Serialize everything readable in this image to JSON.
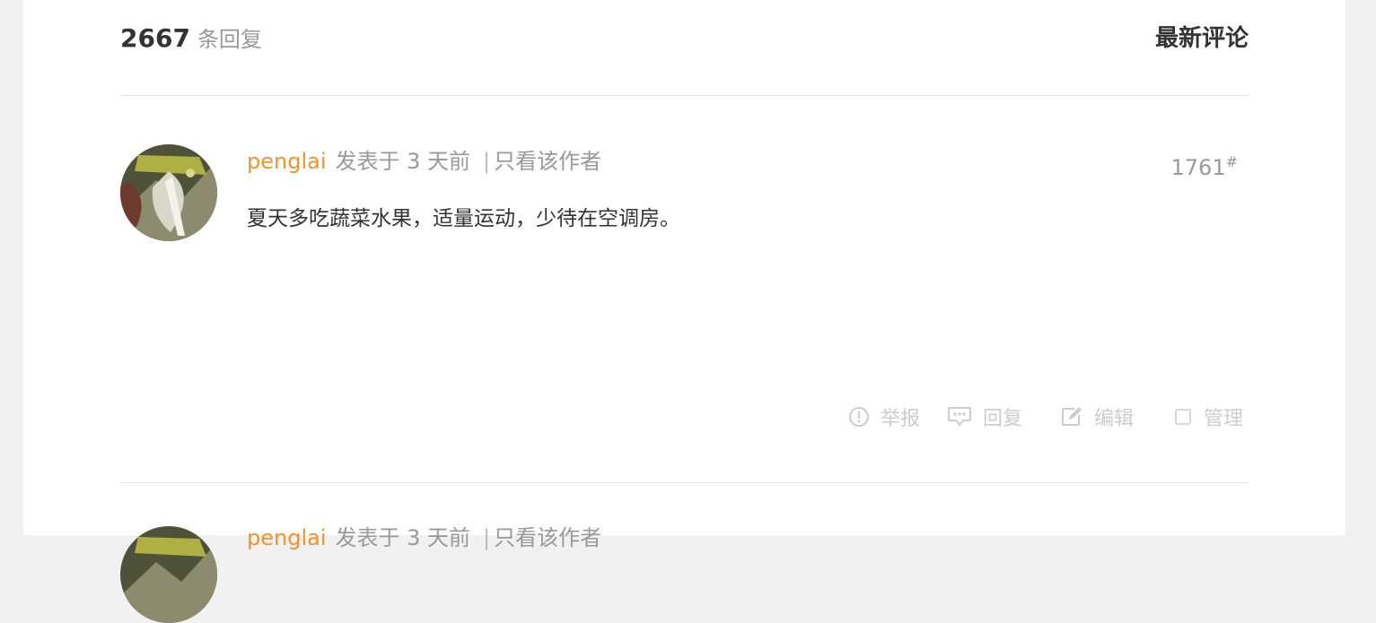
{
  "header": {
    "reply_count": "2667",
    "reply_suffix": "条回复",
    "sort_label": "最新评论"
  },
  "comment": {
    "author": "penglai",
    "posted": "发表于 3 天前",
    "separator": "|",
    "only_author": "只看该作者",
    "floor": "1761",
    "floor_mark": "#",
    "text": "夏天多吃蔬菜水果，适量运动，少待在空调房。",
    "actions": {
      "report": "举报",
      "reply": "回复",
      "edit": "编辑",
      "manage": "管理"
    }
  },
  "next_comment": {
    "author": "penglai",
    "posted": "发表于 3 天前",
    "separator": "|",
    "only_author": "只看该作者"
  },
  "colors": {
    "author": "#f1932f",
    "muted": "#999999",
    "text": "#333333",
    "action": "#cccccc",
    "divider": "#e3e3e3",
    "page_bg": "#f1f1f1"
  },
  "icons": {
    "report": "alert-circle-icon",
    "reply": "chat-bubble-icon",
    "edit": "pencil-square-icon",
    "manage": "checkbox-icon"
  }
}
